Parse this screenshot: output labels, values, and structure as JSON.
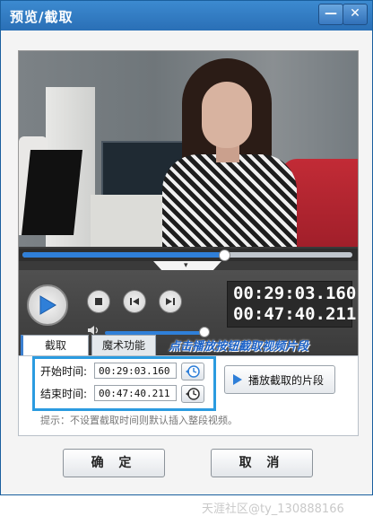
{
  "window": {
    "title": "预览/截取",
    "minimize_glyph": "—",
    "close_glyph": "✕"
  },
  "player": {
    "progress_fraction": 0.61,
    "volume_fraction": 1.0,
    "current_time": "00:29:03.160",
    "total_time": "00:47:40.211",
    "icons": [
      "play-icon",
      "stop-icon",
      "previous-frame-icon",
      "next-frame-icon",
      "volume-icon",
      "chevron-down-icon"
    ]
  },
  "tabs": [
    {
      "label": "截取",
      "active": true
    },
    {
      "label": "魔术功能",
      "active": false
    }
  ],
  "hint_title": "点击播放按钮截取视频片段",
  "clip": {
    "start_label": "开始时间:",
    "start_value": "00:29:03.160",
    "end_label": "结束时间:",
    "end_value": "00:47:40.211",
    "play_segment_label": "播放截取的片段",
    "tip": "提示：不设置截取时间则默认插入整段视频。"
  },
  "buttons": {
    "ok_label": "确 定",
    "cancel_label": "取 消"
  },
  "watermark": "天涯社区@ty_130888166",
  "colors": {
    "titlebar": "#2a6fb6",
    "accent": "#2f7fd8",
    "highlight_border": "#2b9be0",
    "hint_title": "#1d63c8"
  }
}
